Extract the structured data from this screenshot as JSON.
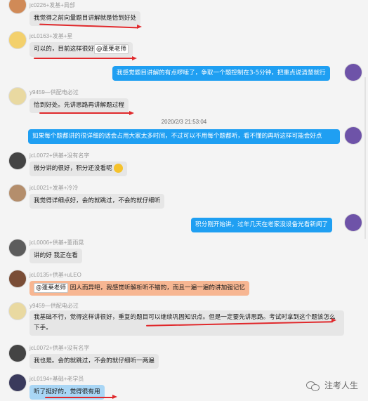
{
  "messages": [
    {
      "sender": "jc0226+发基+局部",
      "text": "我觉得之前向量题目讲解就是恰到好处",
      "side": "left"
    },
    {
      "sender": "jcL0163+发基+星",
      "text": "可以的，目前这样很好",
      "mention": "@蓬莱老师",
      "side": "left"
    },
    {
      "sender": "",
      "text": "我感觉题目讲解的有点啰嗦了，争取一个题控制在3-5分钟，把重点说清楚就行",
      "side": "right"
    },
    {
      "sender": "y9459—供配电必过",
      "text": "恰到好处。先讲思路再讲解题过程",
      "side": "left"
    },
    {
      "sender": "",
      "text": "如果每个题都讲的很详细的话会占用大家太多时间，不过可以不用每个题都听，看不懂的再听这样可能会好点",
      "side": "right"
    },
    {
      "sender": "jcL0072+供基+没有名字",
      "text": "微分讲的很好，积分还没看呢",
      "side": "left"
    },
    {
      "sender": "jcL0021+发基+冷冷",
      "text": "我觉得详细点好，会的就跳过，不会的就仔细听",
      "side": "left"
    },
    {
      "sender": "",
      "text": "积分刚开始讲，过年几天在老家没设备光看新闻了",
      "side": "right"
    },
    {
      "sender": "jcL0006+供基+董雨晃",
      "text": "讲的好  我正在看",
      "side": "left"
    },
    {
      "sender": "jcL0135+供基+uLEO",
      "mention": "@蓬莱老师",
      "text": "因人而异吧，我感觉听解析听不错的，而且一遍一遍的讲加强记忆",
      "side": "left"
    },
    {
      "sender": "y9459—供配电必过",
      "text": "我基础不行，觉得这样讲很好，重复的题目可以继续巩固知识点。但是一定要先讲思路。考试时拿到这个题该怎么下手。",
      "side": "left"
    },
    {
      "sender": "jcL0072+供基+没有名字",
      "text": "我也是。会的就跳过，不会的就仔细听一两遍",
      "side": "left"
    },
    {
      "sender": "jcL0194+基础+老学员",
      "text": "听了挺好的，觉得很有用",
      "side": "left"
    }
  ],
  "timestamp": "2020/2/3 21:53:04",
  "watermark": "注考人生",
  "icons": {
    "watermark": "wechat-logo-icon",
    "emoji": "grin-emoji-icon"
  }
}
